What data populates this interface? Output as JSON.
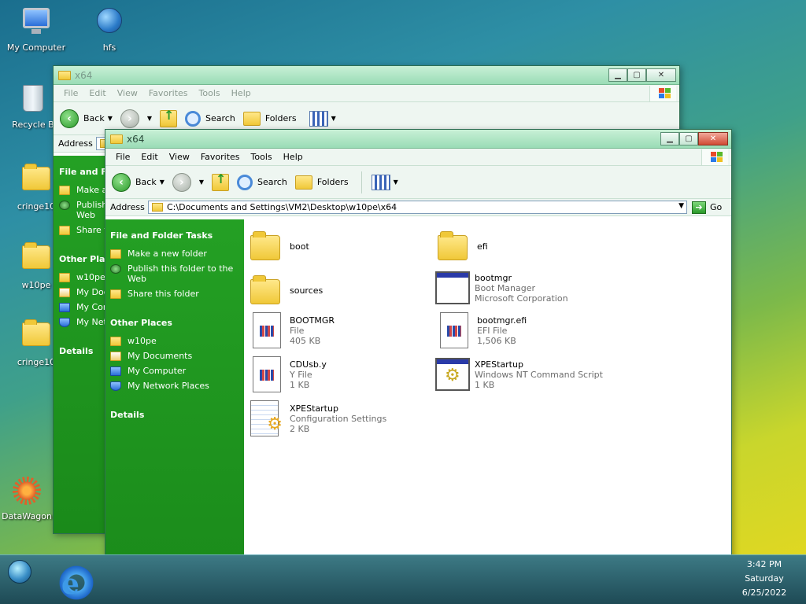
{
  "desktop": {
    "icons": [
      {
        "label": "My Computer"
      },
      {
        "label": "hfs"
      },
      {
        "label": "Recycle B"
      },
      {
        "label": "cringe10"
      },
      {
        "label": "w10pe"
      },
      {
        "label": "cringe10"
      },
      {
        "label": "DataWagon"
      }
    ]
  },
  "back_window": {
    "title": "x64",
    "menu": [
      "File",
      "Edit",
      "View",
      "Favorites",
      "Tools",
      "Help"
    ],
    "toolbar": {
      "back": "Back",
      "search": "Search",
      "folders": "Folders"
    },
    "address_label": "Address",
    "sidebar": {
      "head1": "File and Fo",
      "items1": [
        "Make a",
        "Publish Web",
        "Share t"
      ],
      "head2": "Other Place",
      "items2": [
        "w10pe",
        "My Doc",
        "My Cor",
        "My Net"
      ],
      "head3": "Details"
    }
  },
  "front_window": {
    "title": "x64",
    "menu": [
      "File",
      "Edit",
      "View",
      "Favorites",
      "Tools",
      "Help"
    ],
    "toolbar": {
      "back": "Back",
      "search": "Search",
      "folders": "Folders"
    },
    "address_label": "Address",
    "address_value": "C:\\Documents and Settings\\VM2\\Desktop\\w10pe\\x64",
    "go_label": "Go",
    "sidebar": {
      "tasks_head": "File and Folder Tasks",
      "tasks": [
        "Make a new folder",
        "Publish this folder to the Web",
        "Share this folder"
      ],
      "places_head": "Other Places",
      "places": [
        "w10pe",
        "My Documents",
        "My Computer",
        "My Network Places"
      ],
      "details_head": "Details"
    },
    "files": [
      {
        "name": "boot",
        "line2": "",
        "line3": ""
      },
      {
        "name": "efi",
        "line2": "",
        "line3": ""
      },
      {
        "name": "sources",
        "line2": "",
        "line3": ""
      },
      {
        "name": "bootmgr",
        "line2": "Boot Manager",
        "line3": "Microsoft Corporation"
      },
      {
        "name": "BOOTMGR",
        "line2": "File",
        "line3": "405 KB"
      },
      {
        "name": "bootmgr.efi",
        "line2": "EFI File",
        "line3": "1,506 KB"
      },
      {
        "name": "CDUsb.y",
        "line2": "Y File",
        "line3": "1 KB"
      },
      {
        "name": "XPEStartup",
        "line2": "Windows NT Command Script",
        "line3": "1 KB"
      },
      {
        "name": "XPEStartup",
        "line2": "Configuration Settings",
        "line3": "2 KB"
      }
    ]
  },
  "taskbar": {
    "time": "3:42 PM",
    "day": "Saturday",
    "date": "6/25/2022"
  }
}
